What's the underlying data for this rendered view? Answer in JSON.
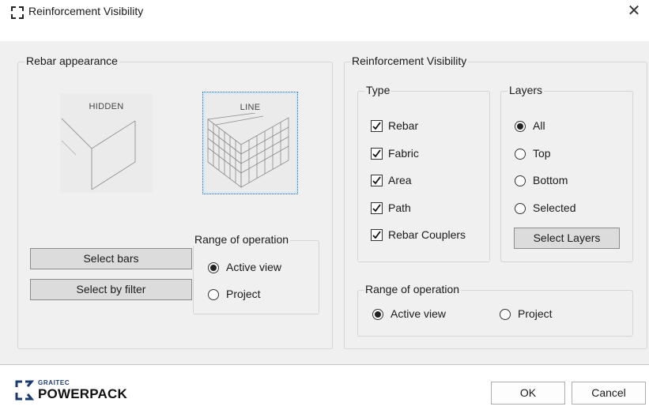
{
  "window": {
    "title": "Reinforcement Visibility",
    "close_glyph": "✕"
  },
  "rebar_appearance": {
    "title": "Rebar appearance",
    "thumbnails": [
      {
        "label": "HIDDEN",
        "selected": false
      },
      {
        "label": "LINE",
        "selected": true
      }
    ],
    "select_bars_label": "Select bars",
    "select_by_filter_label": "Select by filter",
    "range": {
      "title": "Range of operation",
      "options": [
        {
          "label": "Active view",
          "selected": true
        },
        {
          "label": "Project",
          "selected": false
        }
      ]
    }
  },
  "reinforcement_visibility": {
    "title": "Reinforcement Visibility",
    "type": {
      "title": "Type",
      "items": [
        {
          "label": "Rebar",
          "checked": true
        },
        {
          "label": "Fabric",
          "checked": true
        },
        {
          "label": "Area",
          "checked": true
        },
        {
          "label": "Path",
          "checked": true
        },
        {
          "label": "Rebar Couplers",
          "checked": true
        }
      ]
    },
    "layers": {
      "title": "Layers",
      "options": [
        {
          "label": "All",
          "selected": true
        },
        {
          "label": "Top",
          "selected": false
        },
        {
          "label": "Bottom",
          "selected": false
        },
        {
          "label": "Selected",
          "selected": false
        }
      ],
      "select_layers_label": "Select Layers"
    },
    "range": {
      "title": "Range of operation",
      "options": [
        {
          "label": "Active view",
          "selected": true
        },
        {
          "label": "Project",
          "selected": false
        }
      ]
    }
  },
  "footer": {
    "logo_top": "GRAITEC",
    "logo_main": "POWERPACK",
    "ok_label": "OK",
    "cancel_label": "Cancel"
  },
  "colors": {
    "brand_blue": "#1a3a6e",
    "selection_dotted": "#2a6fb0",
    "background": "#f0f0f0"
  },
  "icons": [
    "app-bracket-icon",
    "close-icon",
    "checkbox-checked-icon",
    "radio-selected-icon",
    "radio-unselected-icon",
    "graitec-logo-icon"
  ]
}
